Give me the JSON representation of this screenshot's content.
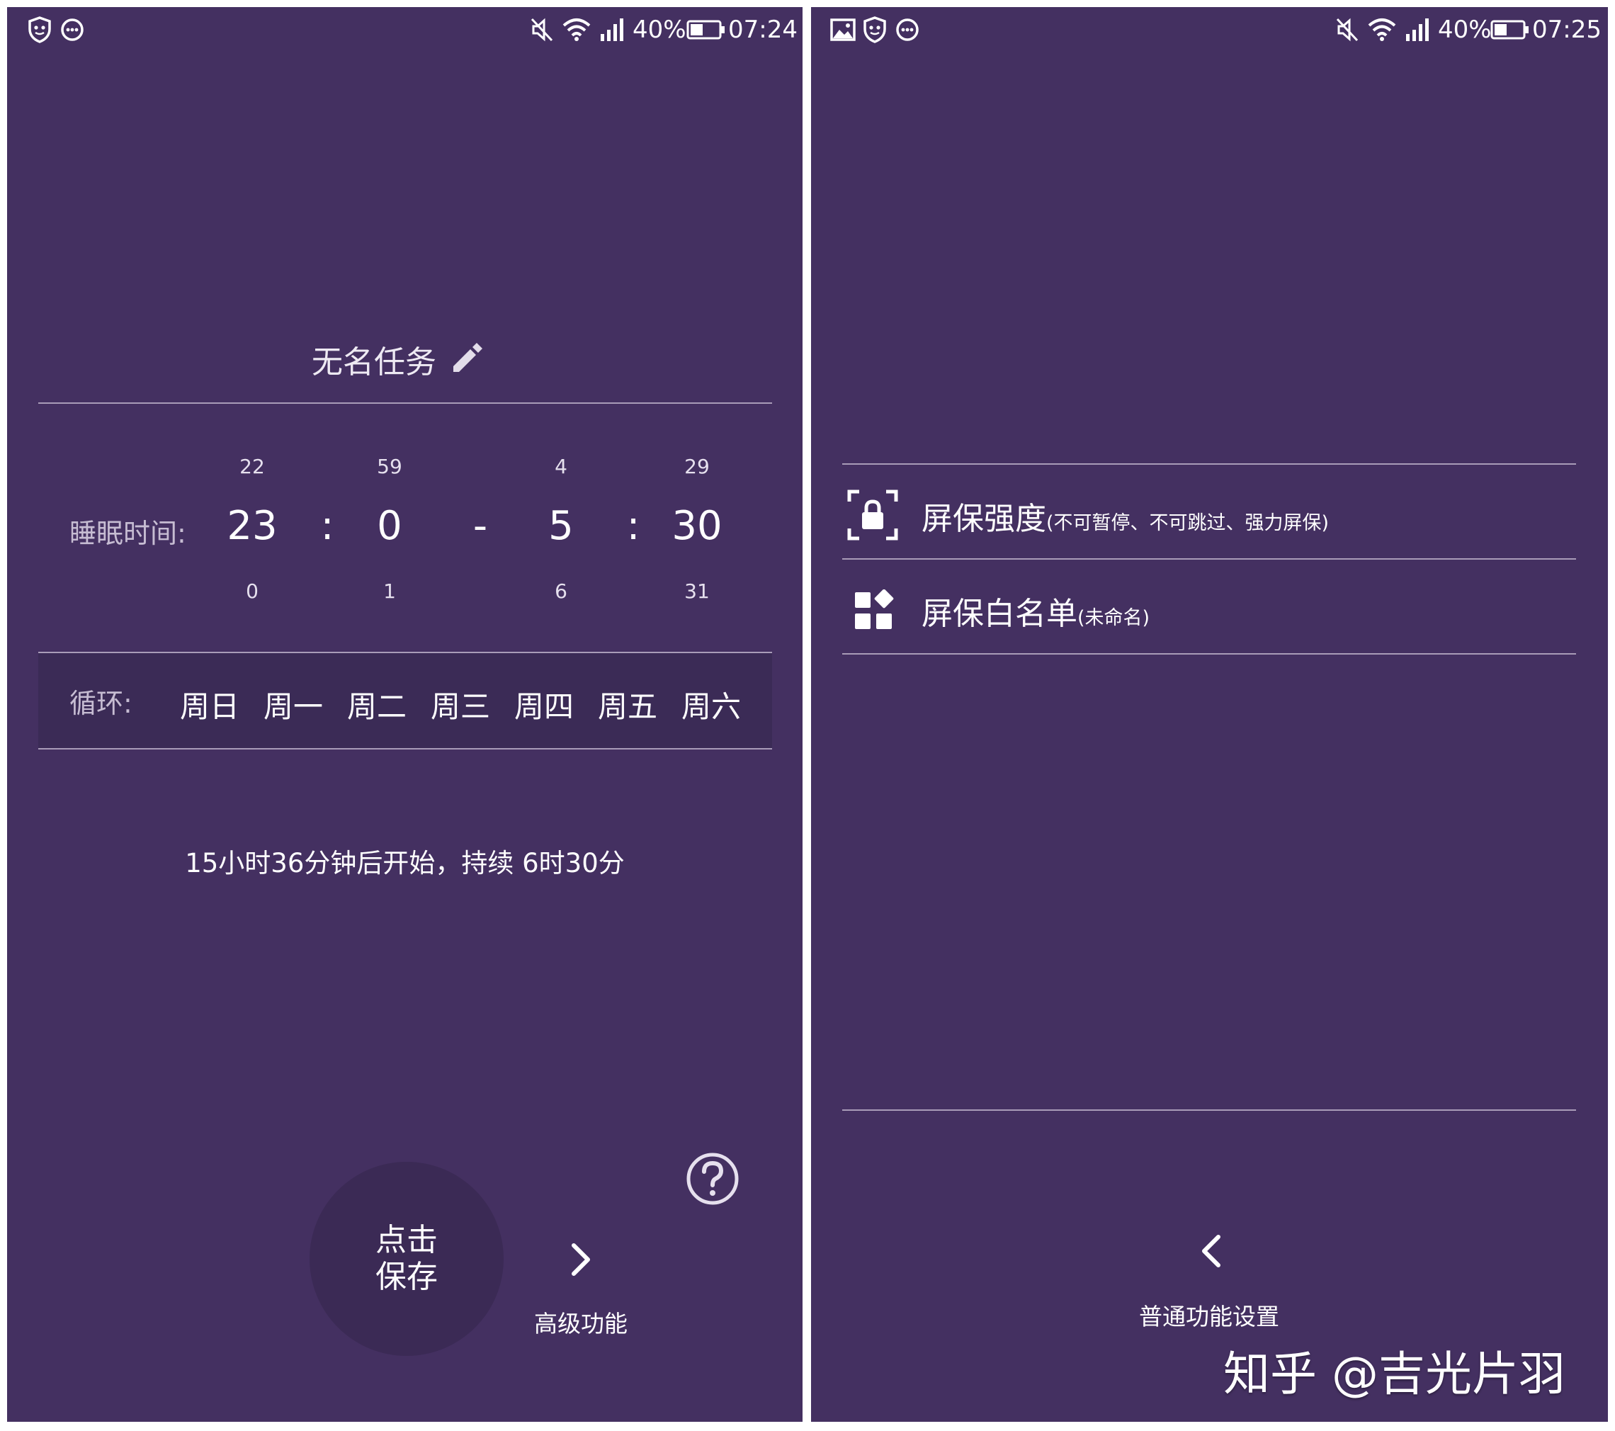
{
  "colors": {
    "background": "#443061",
    "divider": "#a99cb8",
    "save_button": "#3b2a55",
    "cycle_row": "#3b2b56"
  },
  "status_left": {
    "battery": "40%",
    "time": "07:24",
    "icons": [
      "shield-icon",
      "chat-icon",
      "mute-icon",
      "wifi-icon",
      "signal-icon",
      "battery-icon"
    ]
  },
  "status_right": {
    "battery": "40%",
    "time": "07:25",
    "icons": [
      "gallery-icon",
      "shield-icon",
      "chat-icon",
      "mute-icon",
      "wifi-icon",
      "signal-icon",
      "battery-icon"
    ]
  },
  "task": {
    "name": "无名任务",
    "icon": "pencil-icon"
  },
  "sleep": {
    "label": "睡眠时间:",
    "start_hour": {
      "prev": "22",
      "value": "23",
      "next": "0"
    },
    "start_minute": {
      "prev": "59",
      "value": "0",
      "next": "1"
    },
    "end_hour": {
      "prev": "4",
      "value": "5",
      "next": "6"
    },
    "end_minute": {
      "prev": "29",
      "value": "30",
      "next": "31"
    },
    "colon": ":",
    "dash": "-"
  },
  "cycle": {
    "label": "循环:",
    "days": [
      "周日",
      "周一",
      "周二",
      "周三",
      "周四",
      "周五",
      "周六"
    ]
  },
  "countdown": "15小时36分钟后开始，持续 6时30分",
  "save_button": {
    "line1": "点击",
    "line2": "保存"
  },
  "advanced": {
    "label": "高级功能",
    "icon": "chevron-right-icon"
  },
  "help_icon": "help-icon",
  "settings": [
    {
      "title": "屏保强度",
      "subtitle": "(不可暂停、不可跳过、强力屏保)",
      "icon": "lock-scan-icon"
    },
    {
      "title": "屏保白名单",
      "subtitle": "(未命名)",
      "icon": "apps-icon"
    }
  ],
  "back": {
    "label": "普通功能设置",
    "icon": "chevron-left-icon"
  },
  "watermark": "知乎 @吉光片羽"
}
